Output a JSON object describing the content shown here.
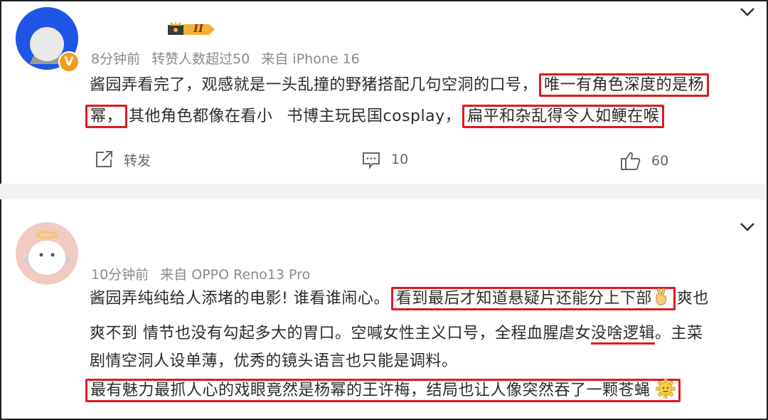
{
  "comments": [
    {
      "badge_numeral": "II",
      "verified_mark": "V",
      "time": "8分钟前",
      "repost_note": "转赞人数超过50",
      "source": "来自 iPhone 16",
      "lines": [
        [
          "酱园弄看完了，观感就是一头乱撞的野猪搭配几句空洞的口号，",
          "唯一有角色深度的是杨"
        ],
        [
          "幂，",
          "其他角色都像在看小",
          "书博主玩民国cosplay，",
          "扁平和杂乱得令人如鲠在喉"
        ]
      ],
      "actions": {
        "repost": "转发",
        "comments": "10",
        "likes": "60"
      }
    },
    {
      "time": "10分钟前",
      "source": "来自 OPPO Reno13 Pro",
      "lines": [
        [
          "酱园弄纯纯给人添堵的电影! 谁看谁闹心。",
          "看到最后才知道悬疑片还能分上下部",
          "✌",
          "爽也"
        ],
        [
          "爽不到 情节也没有勾起多大的胃口。空喊女性主义口号，全程血腥虐女",
          "没啥逻辑",
          "。主菜"
        ],
        [
          "剧情空洞人设单薄，优秀的镜头语言也只能是调料。"
        ],
        [
          "最有魅力最抓人心的戏眼竟然是杨幂的王许梅，结局也让人像突然吞了一颗苍蝇"
        ]
      ]
    }
  ],
  "icons": [
    "chevron-down-icon",
    "repost-icon",
    "comment-icon",
    "like-icon",
    "crown-icon",
    "victory-hand-icon",
    "smiley-icon"
  ],
  "colors": {
    "highlight": "#e0191e",
    "verified": "#f59b16",
    "avatar1_bg": "#1f55e6",
    "divider": "#f2f2f2"
  }
}
